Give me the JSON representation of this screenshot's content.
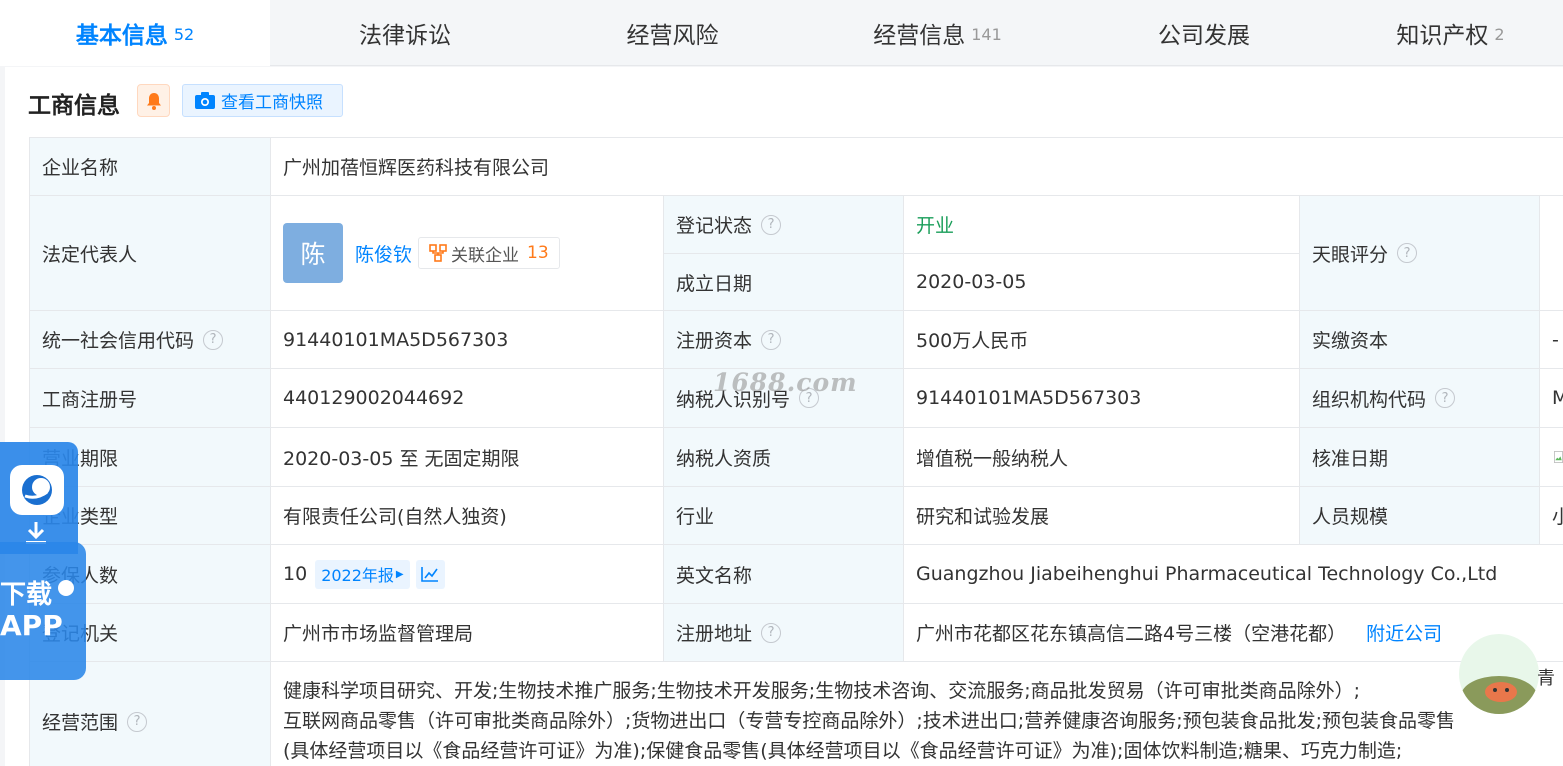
{
  "tabs": [
    {
      "label": "基本信息",
      "count": "52"
    },
    {
      "label": "法律诉讼",
      "count": ""
    },
    {
      "label": "经营风险",
      "count": ""
    },
    {
      "label": "经营信息",
      "count": "141"
    },
    {
      "label": "公司发展",
      "count": ""
    },
    {
      "label": "知识产权",
      "count": "2"
    }
  ],
  "section": {
    "title": "工商信息",
    "snapshot_button": "查看工商快照"
  },
  "company": {
    "name_label": "企业名称",
    "name": "广州加蓓恒辉医药科技有限公司",
    "legal_rep_label": "法定代表人",
    "legal_rep_avatar": "陈",
    "legal_rep_name": "陈俊钦",
    "related_label": "关联企业",
    "related_count": "13",
    "reg_status_label": "登记状态",
    "reg_status": "开业",
    "found_date_label": "成立日期",
    "found_date": "2020-03-05",
    "tianyan_label": "天眼评分",
    "credit_code_label": "统一社会信用代码",
    "credit_code": "91440101MA5D567303",
    "reg_capital_label": "注册资本",
    "reg_capital": "500万人民币",
    "paid_capital_label": "实缴资本",
    "paid_capital": "-",
    "reg_no_label": "工商注册号",
    "reg_no": "440129002044692",
    "taxpayer_id_label": "纳税人识别号",
    "taxpayer_id": "91440101MA5D567303",
    "org_code_label": "组织机构代码",
    "org_code": "M",
    "term_label": "营业期限",
    "term": "2020-03-05 至 无固定期限",
    "taxpayer_qual_label": "纳税人资质",
    "taxpayer_qual": "增值税一般纳税人",
    "approve_date_label": "核准日期",
    "type_label": "企业类型",
    "type": "有限责任公司(自然人独资)",
    "industry_label": "行业",
    "industry": "研究和试验发展",
    "staff_label": "人员规模",
    "staff": "小",
    "insured_label": "参保人数",
    "insured": "10",
    "annual_report": "2022年报",
    "english_name_label": "英文名称",
    "english_name": "Guangzhou Jiabeihenghui Pharmaceutical Technology Co.,Ltd",
    "authority_label": "登记机关",
    "authority": "广州市市场监督管理局",
    "address_label": "注册地址",
    "address": "广州市花都区花东镇高信二路4号三楼（空港花都）",
    "nearby": "附近公司",
    "scope_label": "经营范围",
    "scope_lines": [
      "健康科学项目研究、开发;生物技术推广服务;生物技术开发服务;生物技术咨询、交流服务;商品批发贸易（许可审批类商品除外）;",
      "互联网商品零售（许可审批类商品除外）;货物进出口（专营专控商品除外）;技术进出口;营养健康咨询服务;预包装食品批发;预包装食品零售",
      "(具体经营项目以《食品经营许可证》为准);保健食品零售(具体经营项目以《食品经营许可证》为准);固体饮料制造;糖果、巧克力制造;"
    ]
  },
  "watermark": "1688.com",
  "app_float": {
    "line1": "下载",
    "line2": "APP"
  },
  "mascot_tag": "青"
}
